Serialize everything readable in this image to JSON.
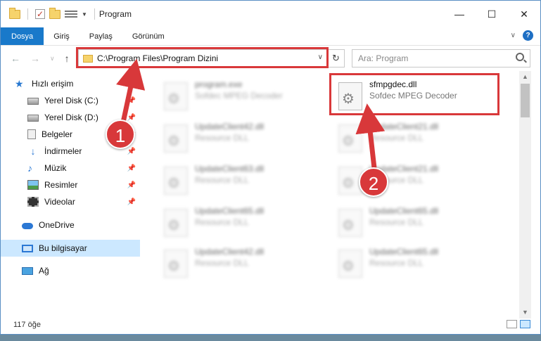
{
  "window": {
    "title": "Program",
    "controls": {
      "minimize": "—",
      "maximize": "☐",
      "close": "✕"
    }
  },
  "ribbon": {
    "tabs": [
      {
        "label": "Dosya",
        "active": true
      },
      {
        "label": "Giriş"
      },
      {
        "label": "Paylaş"
      },
      {
        "label": "Görünüm"
      }
    ],
    "help": "?"
  },
  "address": {
    "path": "C:\\Program Files\\Program Dizini",
    "search_placeholder": "Ara: Program"
  },
  "sidebar": {
    "items": [
      {
        "label": "Hızlı erişim",
        "icon": "star-icon"
      },
      {
        "label": "Yerel Disk (C:)",
        "icon": "disk-icon",
        "pinned": true
      },
      {
        "label": "Yerel Disk (D:)",
        "icon": "disk-icon",
        "pinned": true
      },
      {
        "label": "Belgeler",
        "icon": "documents-icon",
        "pinned": true
      },
      {
        "label": "İndirmeler",
        "icon": "download-icon",
        "pinned": true
      },
      {
        "label": "Müzik",
        "icon": "music-icon",
        "pinned": true
      },
      {
        "label": "Resimler",
        "icon": "pictures-icon",
        "pinned": true
      },
      {
        "label": "Videolar",
        "icon": "videos-icon",
        "pinned": true
      },
      {
        "label": "OneDrive",
        "icon": "onedrive-icon"
      },
      {
        "label": "Bu bilgisayar",
        "icon": "computer-icon",
        "selected": true
      },
      {
        "label": "Ağ",
        "icon": "network-icon"
      }
    ]
  },
  "files": [
    {
      "name": "program.exe",
      "desc": "Sofdec MPEG Decoder",
      "blurred": true
    },
    {
      "name": "sfmpgdec.dll",
      "desc": "Sofdec MPEG Decoder",
      "blurred": false
    },
    {
      "name": "UpdateClient42.dll",
      "desc": "Resource DLL",
      "blurred": true
    },
    {
      "name": "UpdateClient21.dll",
      "desc": "Resource DLL",
      "blurred": true
    },
    {
      "name": "UpdateClient63.dll",
      "desc": "Resource DLL",
      "blurred": true
    },
    {
      "name": "UpdateClient21.dll",
      "desc": "Resource DLL",
      "blurred": true
    },
    {
      "name": "UpdateClient65.dll",
      "desc": "Resource DLL",
      "blurred": true
    },
    {
      "name": "UpdateClient65.dll",
      "desc": "Resource DLL",
      "blurred": true
    },
    {
      "name": "UpdateClient42.dll",
      "desc": "Resource DLL",
      "blurred": true
    },
    {
      "name": "UpdateClient65.dll",
      "desc": "Resource DLL",
      "blurred": true
    }
  ],
  "status": {
    "item_count": "117 öğe"
  },
  "annotations": {
    "marker1": "1",
    "marker2": "2",
    "highlight_color": "#d9383a"
  },
  "pin_glyph": "📌"
}
